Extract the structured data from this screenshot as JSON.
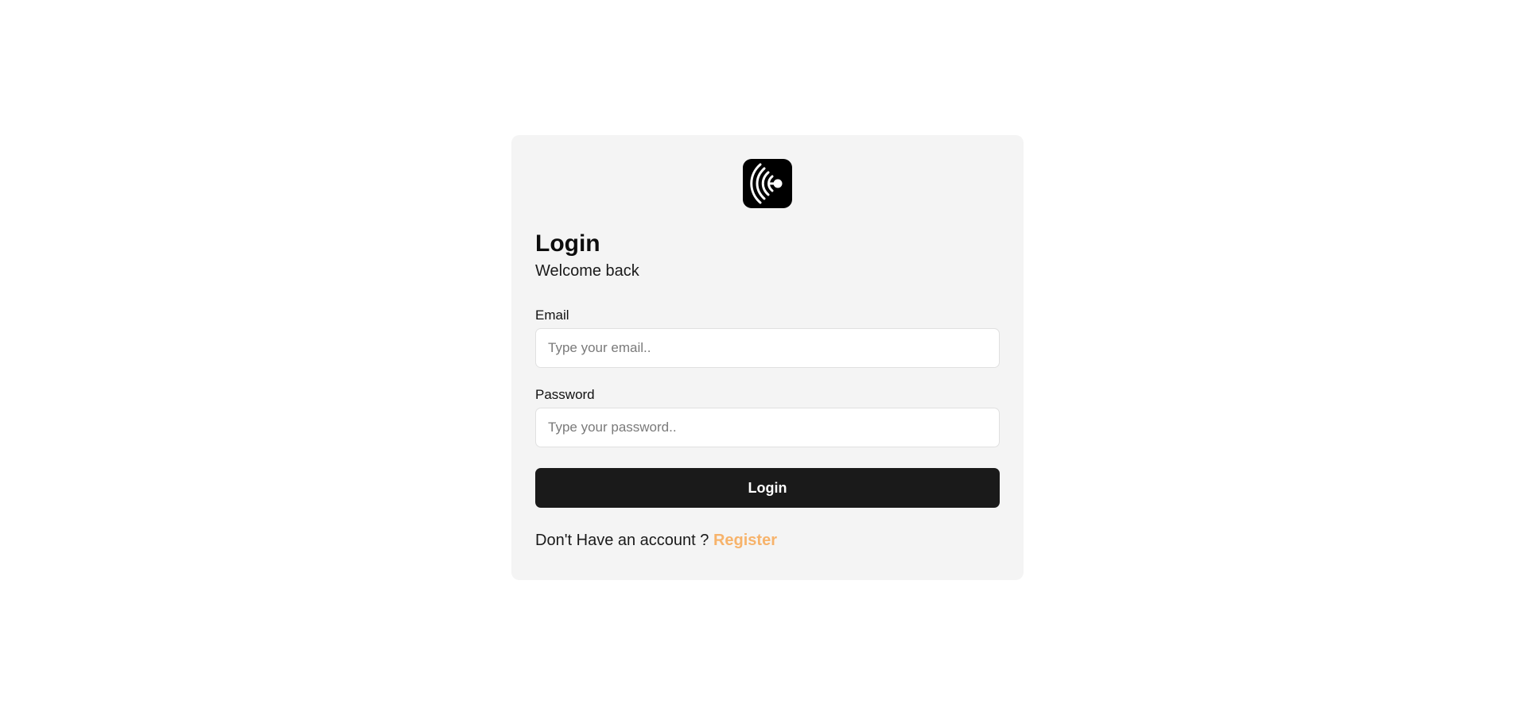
{
  "brand": {
    "logo_icon": "radio-waves-icon",
    "logo_bg": "#000000"
  },
  "login": {
    "title": "Login",
    "subtitle": "Welcome back",
    "email": {
      "label": "Email",
      "value": "",
      "placeholder": "Type your email.."
    },
    "password": {
      "label": "Password",
      "value": "",
      "placeholder": "Type your password.."
    },
    "submit_label": "Login",
    "register_prompt": "Don't Have an account ? ",
    "register_link": "Register"
  },
  "colors": {
    "card_bg": "#f4f4f4",
    "button_bg": "#1a1a1a",
    "accent": "#f7b36b"
  }
}
